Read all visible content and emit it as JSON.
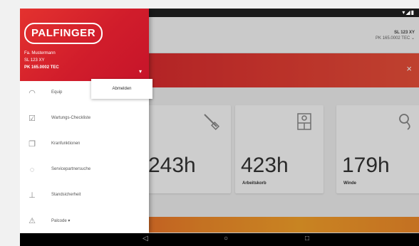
{
  "status": {
    "icons": "▾◢▮"
  },
  "appbar": {
    "line1": "SL 123 XY",
    "line2": "PK 165.0002 TEC ⌄"
  },
  "banner": {
    "close_glyph": "×"
  },
  "cards": [
    {
      "hours": "243h",
      "label": "",
      "icon": "crane-hook-icon"
    },
    {
      "hours": "423h",
      "label": "Arbeitskorb",
      "icon": "basket-icon"
    },
    {
      "hours": "179h",
      "label": "Winde",
      "icon": "winch-icon"
    }
  ],
  "nav": {
    "back": "◁",
    "home": "○",
    "recent": "□"
  },
  "drawer": {
    "logo": "PALFINGER",
    "user": {
      "name": "Fa. Mustermann",
      "plate": "SL 123 XY",
      "model": "PK 165.0002 TEC"
    },
    "popup": "Abmelden",
    "items": [
      {
        "label": "Equip",
        "icon": "gauge-icon"
      },
      {
        "label": "Wartungs-Checkliste",
        "icon": "checklist-icon"
      },
      {
        "label": "Kranfunktionen",
        "icon": "copy-icon"
      },
      {
        "label": "Servicepartnersuche",
        "icon": "chat-icon"
      },
      {
        "label": "Standsicherheit",
        "icon": "stability-icon"
      },
      {
        "label": "Palcode ▾",
        "icon": "warning-icon"
      }
    ]
  }
}
